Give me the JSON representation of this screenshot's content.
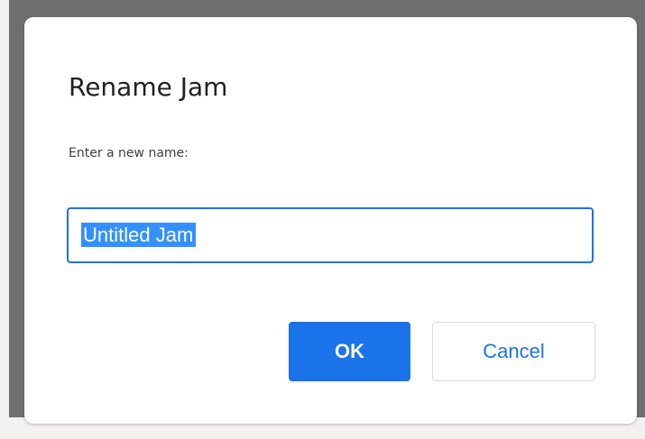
{
  "dialog": {
    "title": "Rename Jam",
    "prompt": "Enter a new name:",
    "input_value": "Untitled Jam",
    "input_selected": true,
    "ok_label": "OK",
    "cancel_label": "Cancel"
  },
  "colors": {
    "accent": "#1a73e8",
    "selection": "#3390ff",
    "backdrop": "#6f6f6f",
    "page_background": "#f3f1ef"
  }
}
